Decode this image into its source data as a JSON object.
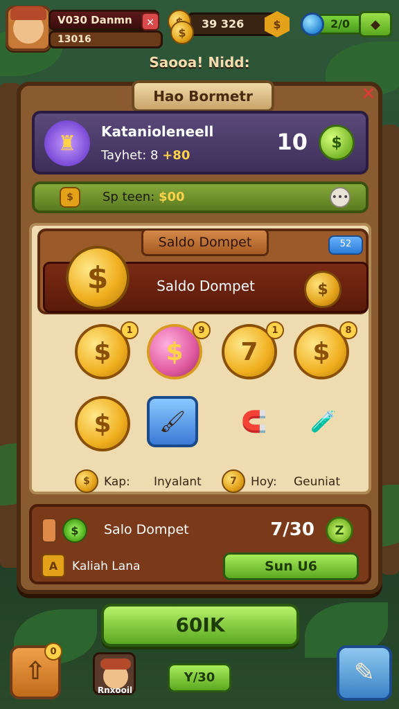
{
  "hud": {
    "player_name": "V030 Danmn",
    "player_level": "13016",
    "coins": "39 326",
    "gems": "2/0"
  },
  "caption": "Saooa! Nidd:",
  "panel": {
    "title": "Hao Bormetr",
    "quest": {
      "title": "Katanioleneell",
      "subtitle_prefix": "Tayhet: 8",
      "subtitle_value": "+80",
      "count": "10"
    },
    "spin": {
      "prefix": "Sp teen:",
      "value": "$00"
    },
    "wallet": {
      "tab_label": "Saldo Dompet",
      "tag": "52",
      "label": "Saldo Dompet"
    },
    "grid": {
      "row1": [
        "$",
        "$",
        "7",
        "$"
      ],
      "row1_badges": [
        "1",
        "9",
        "1",
        "8"
      ]
    },
    "legend": [
      {
        "coin": "$",
        "text": "Kap:"
      },
      {
        "text": "Inyalant"
      },
      {
        "coin": "7",
        "text": "Hoy:"
      },
      {
        "text": "Geuniat"
      }
    ],
    "bottom": {
      "label": "Salo Dompet",
      "value": "7/30",
      "sub_label": "Kaliah Lana",
      "button": "Sun U6"
    }
  },
  "footer": {
    "main_button": "60IK",
    "up_badge": "0",
    "char_name": "Rnxooil",
    "small_button": "Y/30"
  },
  "colors": {
    "accent_green": "#5aa820",
    "panel_brown": "#8a5a30",
    "gold": "#e3a21a"
  }
}
